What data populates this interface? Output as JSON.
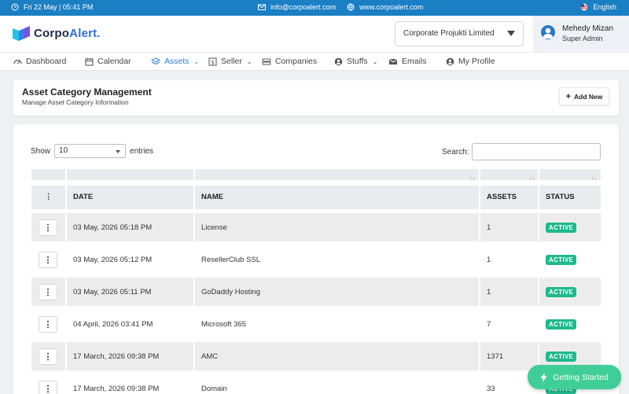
{
  "topbar": {
    "datetime": "Fri 22 May | 05:41 PM",
    "email": "info@corpoalert.com",
    "website": "www.corpoalert.com",
    "language": "English"
  },
  "header": {
    "brand_prefix": "Corpo",
    "brand_suffix": "Alert.",
    "company": "Corporate Projukti Limited",
    "user_name": "Mehedy Mizan",
    "user_role": "Super Admin"
  },
  "nav": {
    "items": [
      {
        "label": "Dashboard",
        "icon": "dashboard-icon"
      },
      {
        "label": "Calendar",
        "icon": "calendar-icon"
      },
      {
        "label": "Assets",
        "icon": "layers-icon",
        "dropdown": true,
        "active": true
      },
      {
        "label": "Seller",
        "icon": "seller-icon",
        "dropdown": true
      },
      {
        "label": "Companies",
        "icon": "companies-icon"
      },
      {
        "label": "Stuffs",
        "icon": "user-icon",
        "dropdown": true
      },
      {
        "label": "Emails",
        "icon": "email-icon"
      },
      {
        "label": "My Profile",
        "icon": "profile-icon"
      }
    ]
  },
  "page": {
    "title": "Asset Category Management",
    "subtitle": "Manage Asset Category Information",
    "add_label": "Add New"
  },
  "table": {
    "show_label": "Show",
    "entries_value": "10",
    "entries_label": "entries",
    "search_label": "Search:",
    "headers": {
      "actions": "⋮",
      "date": "DATE",
      "name": "NAME",
      "assets": "ASSETS",
      "status": "STATUS"
    },
    "rows": [
      {
        "date": "03 May, 2026 05:18 PM",
        "name": "License",
        "assets": "1",
        "status": "ACTIVE"
      },
      {
        "date": "03 May, 2026 05:12 PM",
        "name": "ResellerClub SSL",
        "assets": "1",
        "status": "ACTIVE"
      },
      {
        "date": "03 May, 2026 05:11 PM",
        "name": "GoDaddy Hosting",
        "assets": "1",
        "status": "ACTIVE"
      },
      {
        "date": "04 April, 2026 03:41 PM",
        "name": "Microsoft 365",
        "assets": "7",
        "status": "ACTIVE"
      },
      {
        "date": "17 March, 2026 09:38 PM",
        "name": "AMC",
        "assets": "1371",
        "status": "ACTIVE"
      },
      {
        "date": "17 March, 2026 09:38 PM",
        "name": "Domain",
        "assets": "33",
        "status": "ACTIVE"
      }
    ]
  },
  "getting_started": "Getting Started",
  "colors": {
    "primary": "#1b7fc4",
    "active_badge": "#1fb98b",
    "cta": "#3fce97"
  }
}
